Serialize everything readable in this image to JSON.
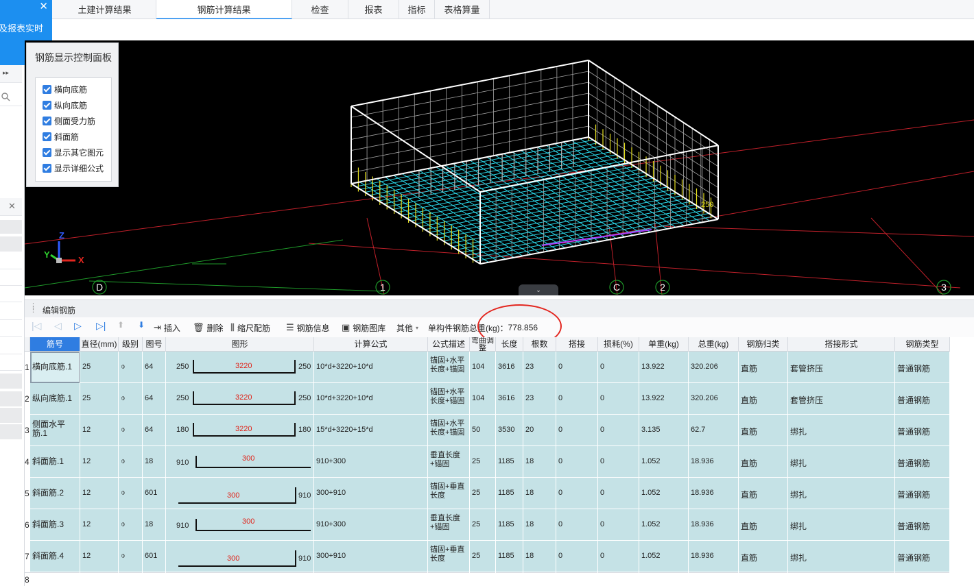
{
  "sidebar": {
    "tab_text": "及报表实时",
    "close": "✕"
  },
  "tabs": [
    {
      "label": "土建计算结果"
    },
    {
      "label": "钢筋计算结果"
    },
    {
      "label": "检查"
    },
    {
      "label": "报表"
    },
    {
      "label": "指标"
    },
    {
      "label": "表格算量"
    }
  ],
  "control_panel": {
    "title": "钢筋显示控制面板",
    "options": [
      {
        "label": "横向底筋",
        "checked": true
      },
      {
        "label": "纵向底筋",
        "checked": true
      },
      {
        "label": "侧面受力筋",
        "checked": true
      },
      {
        "label": "斜面筋",
        "checked": true
      },
      {
        "label": "显示其它图元",
        "checked": true
      },
      {
        "label": "显示详细公式",
        "checked": true
      }
    ]
  },
  "viewport": {
    "axis_labels": [
      "D",
      "1",
      "C",
      "2",
      "3"
    ],
    "axis_x": "X",
    "axis_y": "Y",
    "axis_z": "Z",
    "dim_250": "250"
  },
  "edit_panel": {
    "title": "编辑钢筋",
    "toolbar": {
      "insert": "插入",
      "delete": "删除",
      "scale": "缩尺配筋",
      "info": "钢筋信息",
      "library": "钢筋图库",
      "other": "其他",
      "total_label": "单构件钢筋总重(kg)：",
      "total_value": "778.856"
    }
  },
  "table": {
    "headers": [
      "筋号",
      "直径(mm)",
      "级别",
      "图号",
      "图形",
      "计算公式",
      "公式描述",
      "弯曲调整",
      "长度",
      "根数",
      "搭接",
      "损耗(%)",
      "单重(kg)",
      "总重(kg)",
      "钢筋归类",
      "搭接形式",
      "钢筋类型"
    ],
    "rows": [
      {
        "no": "1",
        "name": "横向底筋.1",
        "dia": "25",
        "grade": "⌽",
        "fig": "64",
        "left": "250",
        "mid": "3220",
        "right": "250",
        "formula": "10*d+3220+10*d",
        "desc": "锚固+水平长度+锚固",
        "bend": "104",
        "len": "3616",
        "count": "23",
        "lap": "0",
        "loss": "0",
        "unit": "13.922",
        "total": "320.206",
        "cat": "直筋",
        "lap_type": "套管挤压",
        "type": "普通钢筋",
        "shape": "u"
      },
      {
        "no": "2",
        "name": "纵向底筋.1",
        "dia": "25",
        "grade": "⌽",
        "fig": "64",
        "left": "250",
        "mid": "3220",
        "right": "250",
        "formula": "10*d+3220+10*d",
        "desc": "锚固+水平长度+锚固",
        "bend": "104",
        "len": "3616",
        "count": "23",
        "lap": "0",
        "loss": "0",
        "unit": "13.922",
        "total": "320.206",
        "cat": "直筋",
        "lap_type": "套管挤压",
        "type": "普通钢筋",
        "shape": "u"
      },
      {
        "no": "3",
        "name": "侧面水平筋.1",
        "dia": "12",
        "grade": "⌽",
        "fig": "64",
        "left": "180",
        "mid": "3220",
        "right": "180",
        "formula": "15*d+3220+15*d",
        "desc": "锚固+水平长度+锚固",
        "bend": "50",
        "len": "3530",
        "count": "20",
        "lap": "0",
        "loss": "0",
        "unit": "3.135",
        "total": "62.7",
        "cat": "直筋",
        "lap_type": "绑扎",
        "type": "普通钢筋",
        "shape": "u"
      },
      {
        "no": "4",
        "name": "斜面筋.1",
        "dia": "12",
        "grade": "⌽",
        "fig": "18",
        "left": "910",
        "mid": "300",
        "right": "",
        "formula": "910+300",
        "desc": "垂直长度+锚固",
        "bend": "25",
        "len": "1185",
        "count": "18",
        "lap": "0",
        "loss": "0",
        "unit": "1.052",
        "total": "18.936",
        "cat": "直筋",
        "lap_type": "绑扎",
        "type": "普通钢筋",
        "shape": "l"
      },
      {
        "no": "5",
        "name": "斜面筋.2",
        "dia": "12",
        "grade": "⌽",
        "fig": "601",
        "left": "",
        "mid": "300",
        "right": "910",
        "formula": "300+910",
        "desc": "锚固+垂直长度",
        "bend": "25",
        "len": "1185",
        "count": "18",
        "lap": "0",
        "loss": "0",
        "unit": "1.052",
        "total": "18.936",
        "cat": "直筋",
        "lap_type": "绑扎",
        "type": "普通钢筋",
        "shape": "r"
      },
      {
        "no": "6",
        "name": "斜面筋.3",
        "dia": "12",
        "grade": "⌽",
        "fig": "18",
        "left": "910",
        "mid": "300",
        "right": "",
        "formula": "910+300",
        "desc": "垂直长度+锚固",
        "bend": "25",
        "len": "1185",
        "count": "18",
        "lap": "0",
        "loss": "0",
        "unit": "1.052",
        "total": "18.936",
        "cat": "直筋",
        "lap_type": "绑扎",
        "type": "普通钢筋",
        "shape": "l"
      },
      {
        "no": "7",
        "name": "斜面筋.4",
        "dia": "12",
        "grade": "⌽",
        "fig": "601",
        "left": "",
        "mid": "300",
        "right": "910",
        "formula": "300+910",
        "desc": "锚固+垂直长度",
        "bend": "25",
        "len": "1185",
        "count": "18",
        "lap": "0",
        "loss": "0",
        "unit": "1.052",
        "total": "18.936",
        "cat": "直筋",
        "lap_type": "绑扎",
        "type": "普通钢筋",
        "shape": "r"
      }
    ],
    "empty_row_no": "8"
  }
}
